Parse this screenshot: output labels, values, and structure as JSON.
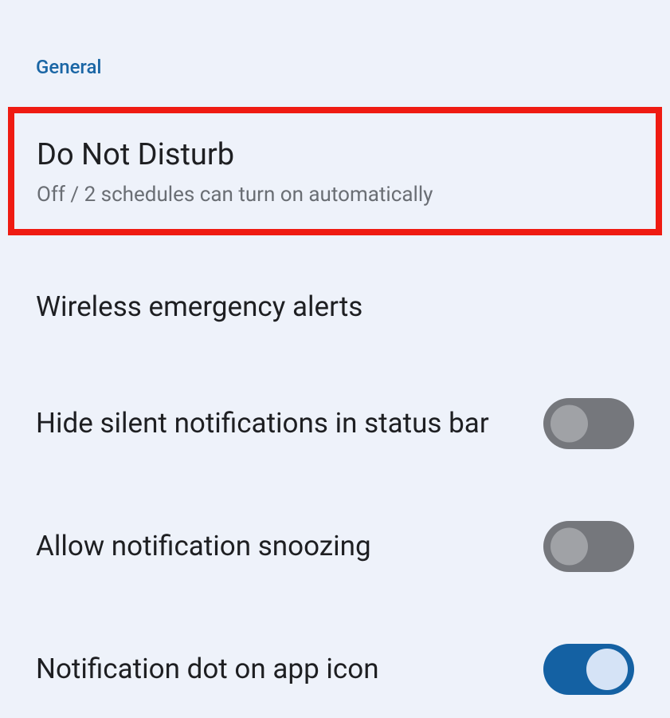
{
  "section_header": "General",
  "items": [
    {
      "title": "Do Not Disturb",
      "subtitle": "Off / 2 schedules can turn on automatically",
      "highlighted": true,
      "has_toggle": false
    },
    {
      "title": "Wireless emergency alerts",
      "subtitle": null,
      "highlighted": false,
      "has_toggle": false
    },
    {
      "title": "Hide silent notifications in status bar",
      "subtitle": null,
      "highlighted": false,
      "has_toggle": true,
      "toggle_on": false
    },
    {
      "title": "Allow notification snoozing",
      "subtitle": null,
      "highlighted": false,
      "has_toggle": true,
      "toggle_on": false
    },
    {
      "title": "Notification dot on app icon",
      "subtitle": null,
      "highlighted": false,
      "has_toggle": true,
      "toggle_on": true
    }
  ]
}
